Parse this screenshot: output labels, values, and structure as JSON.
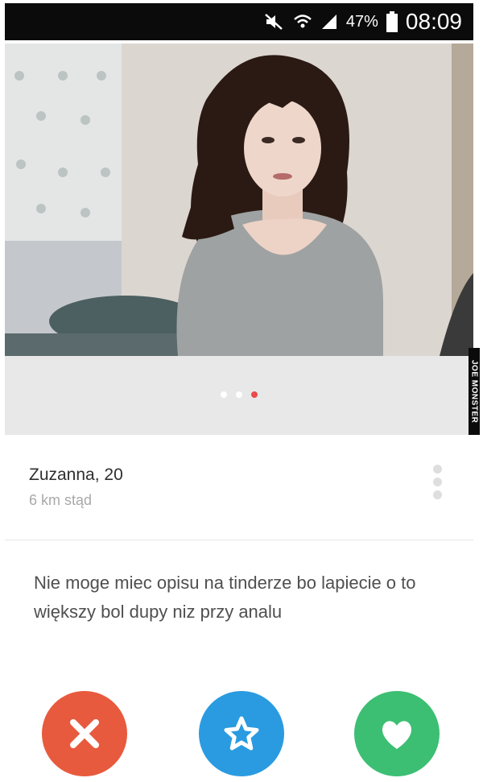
{
  "status_bar": {
    "battery_percent": "47%",
    "time": "08:09",
    "icons": [
      "mute-icon",
      "wifi-icon",
      "signal-icon",
      "battery-icon"
    ]
  },
  "photo": {
    "page_count": 3,
    "active_page": 3
  },
  "watermark": "JOE MONSTER",
  "profile": {
    "name_age": "Zuzanna, 20",
    "distance": "6 km stąd",
    "bio": "Nie moge miec opisu na tinderze bo lapiecie o to większy bol dupy niz przy analu"
  },
  "actions": {
    "nope_icon": "close-icon",
    "super_like_icon": "star-icon",
    "like_icon": "heart-icon"
  },
  "colors": {
    "nope": "#e85a3d",
    "super_like": "#2a9be0",
    "like": "#3cbf73",
    "active_dot": "#e94b4b"
  }
}
